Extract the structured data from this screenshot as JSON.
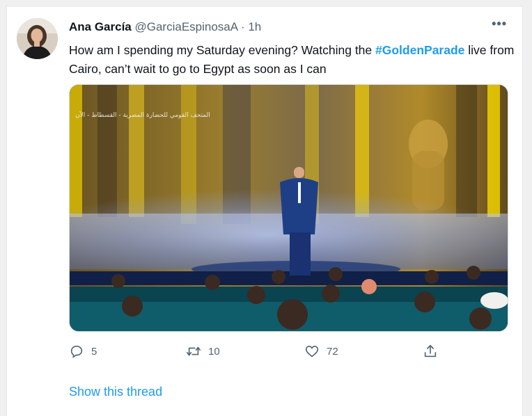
{
  "tweet": {
    "author_name": "Ana García",
    "handle": "@GarciaEspinosaA",
    "separator": "·",
    "time": "1h",
    "more_label": "•••",
    "text_before": "How am I spending my Saturday evening? Watching the ",
    "hashtag": "#GoldenParade",
    "text_after": " live from Cairo, can’t wait to go to Egypt as soon as I can",
    "media": {
      "overlay_text": "المتحف القومي للحضارة المصرية - القسطاط - الآن"
    },
    "actions": {
      "reply_count": "5",
      "retweet_count": "10",
      "like_count": "72"
    },
    "show_thread": "Show this thread"
  },
  "colors": {
    "accent": "#1d9bf0",
    "secondary_text": "#536471",
    "primary_text": "#0f1419"
  },
  "icons": [
    "avatar-photo",
    "more-icon",
    "reply-icon",
    "retweet-icon",
    "like-icon",
    "share-icon"
  ]
}
